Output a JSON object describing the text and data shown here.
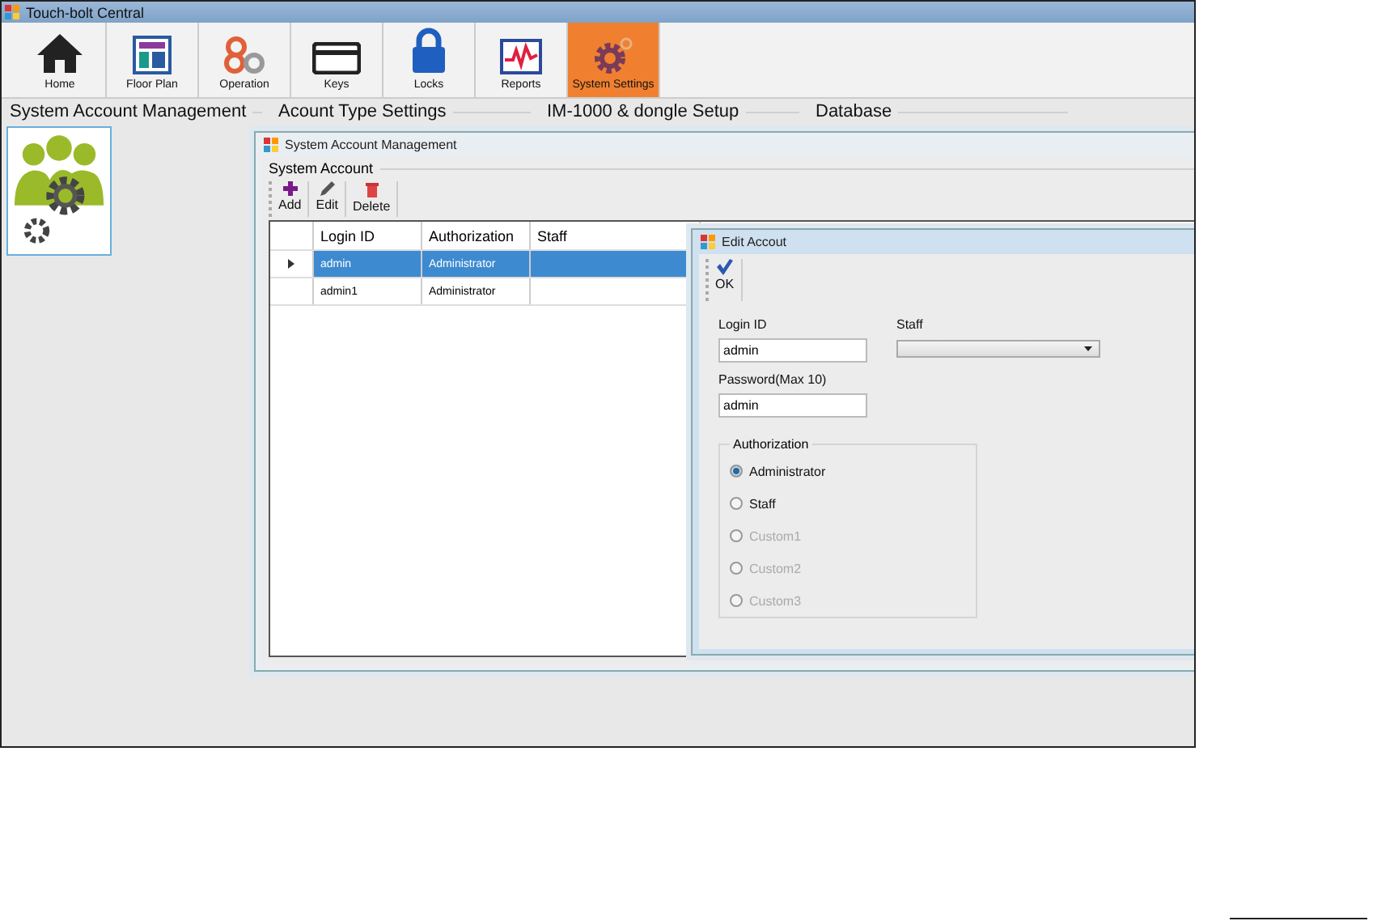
{
  "window": {
    "title": "Touch-bolt Central"
  },
  "toolbar": [
    {
      "label": "Home",
      "selected": false
    },
    {
      "label": "Floor Plan",
      "selected": false
    },
    {
      "label": "Operation",
      "selected": false
    },
    {
      "label": "Keys",
      "selected": false
    },
    {
      "label": "Locks",
      "selected": false
    },
    {
      "label": "Reports",
      "selected": false
    },
    {
      "label": "System Settings",
      "selected": true
    }
  ],
  "sections": [
    "System Account Management",
    "Acount Type Settings",
    "IM-1000 & dongle Setup",
    "Database"
  ],
  "account_window": {
    "title": "System Account Management",
    "group": "System Account",
    "actions": [
      "Add",
      "Edit",
      "Delete"
    ],
    "columns": [
      "Login ID",
      "Authorization",
      "Staff"
    ],
    "rows": [
      {
        "login_id": "admin",
        "authorization": "Administrator",
        "selected": true
      },
      {
        "login_id": "admin1",
        "authorization": "Administrator",
        "selected": false
      }
    ]
  },
  "edit_dialog": {
    "title": "Edit Accout",
    "ok": "OK",
    "login_label": "Login ID",
    "login_value": "admin",
    "staff_label": "Staff",
    "password_label": "Password(Max 10)",
    "password_value": "admin",
    "auth_group": "Authorization",
    "options": [
      {
        "label": "Administrator",
        "selected": true,
        "disabled": false
      },
      {
        "label": "Staff",
        "selected": false,
        "disabled": false
      },
      {
        "label": "Custom1",
        "selected": false,
        "disabled": true
      },
      {
        "label": "Custom2",
        "selected": false,
        "disabled": true
      },
      {
        "label": "Custom3",
        "selected": false,
        "disabled": true
      }
    ]
  }
}
